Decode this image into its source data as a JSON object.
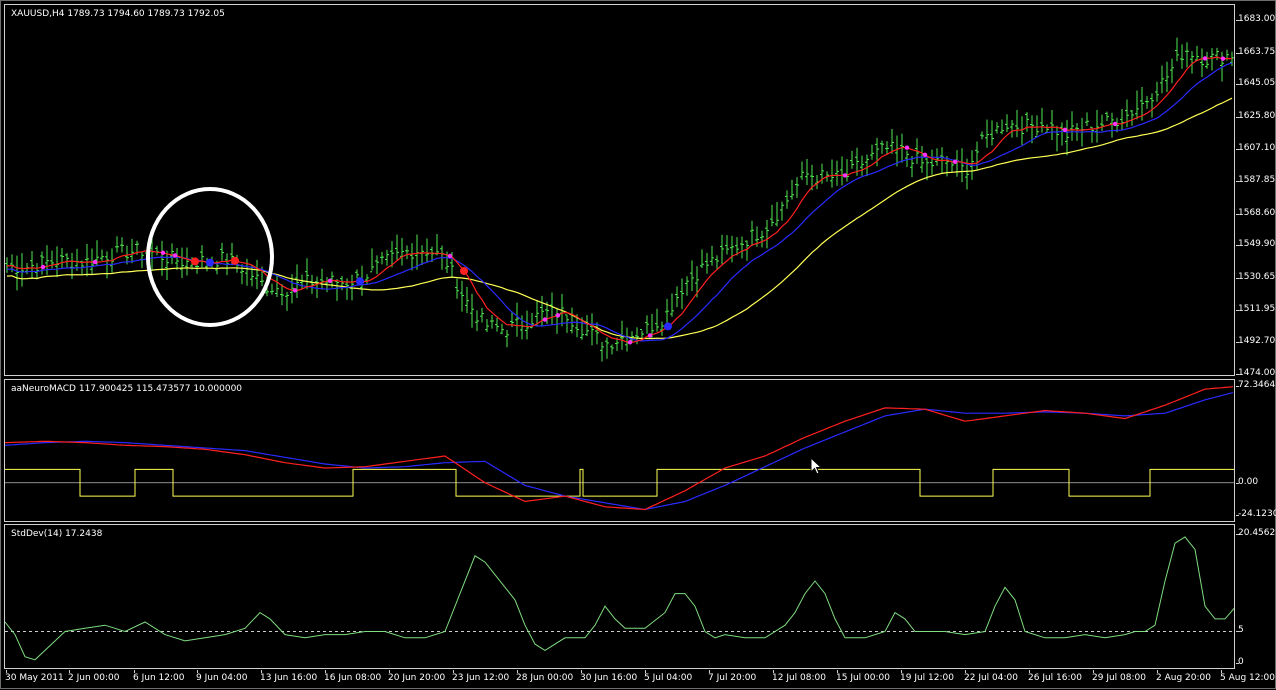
{
  "symbol_header": "XAUUSD,H4  1789.73 1794.60 1789.73 1792.05",
  "macd_header": "aaNeuroMACD 117.900425 115.473577 10.000000",
  "std_header": "StdDev(14) 17.2438",
  "colors": {
    "bars": "#4fe94f",
    "fast_ma": "#ff2020",
    "mid_ma": "#2a2aff",
    "slow_ma": "#ffff55",
    "signal_pink": "#ff33ff",
    "signal_red": "#ff2020",
    "signal_blue": "#2a2aff",
    "stddev_line": "#7fdc7f",
    "macd_main": "#ff2020",
    "macd_signal": "#2a2aff",
    "macd_step": "#ffff55"
  },
  "chart_data": [
    {
      "type": "line",
      "title": "XAUUSD,H4",
      "y_ticks": [
        "1683.00",
        "1663.75",
        "1645.05",
        "1625.80",
        "1607.10",
        "1587.85",
        "1568.60",
        "1549.90",
        "1530.65",
        "1511.95",
        "1492.70",
        "1474.00"
      ],
      "ylim": [
        1474.0,
        1683.0
      ],
      "series": [
        {
          "name": "",
          "kind": "price_bars",
          "x": [
            0,
            20,
            40,
            60,
            80,
            100,
            120,
            140,
            160,
            180,
            200,
            220,
            240,
            260,
            280,
            300,
            320,
            340,
            360,
            380,
            400,
            420,
            440,
            460,
            480,
            500,
            520,
            540,
            560,
            580,
            600,
            620,
            640,
            660,
            680,
            700,
            720,
            740,
            760,
            780,
            800,
            820,
            840,
            860,
            880,
            900,
            920,
            940,
            960,
            980,
            1000,
            1020,
            1040,
            1060,
            1080,
            1100,
            1120,
            1140,
            1160,
            1180,
            1200,
            1220,
            1231
          ],
          "values": [
            1538,
            1537,
            1540,
            1541,
            1540,
            1544,
            1546,
            1547,
            1543,
            1540,
            1541,
            1542,
            1536,
            1526,
            1524,
            1528,
            1529,
            1528,
            1532,
            1540,
            1546,
            1548,
            1542,
            1518,
            1503,
            1500,
            1505,
            1510,
            1510,
            1500,
            1492,
            1496,
            1500,
            1508,
            1528,
            1538,
            1545,
            1553,
            1560,
            1575,
            1592,
            1590,
            1590,
            1600,
            1607,
            1605,
            1597,
            1600,
            1594,
            1613,
            1622,
            1620,
            1622,
            1615,
            1620,
            1622,
            1626,
            1635,
            1648,
            1666,
            1660,
            1662,
            1663
          ]
        }
      ]
    },
    {
      "type": "line",
      "title": "aaNeuroMACD",
      "y_ticks": [
        "72.3464",
        "0.00",
        "-24.1230"
      ],
      "ylim": [
        -24.123,
        72.3464
      ],
      "series": [
        {
          "name": "",
          "x": [
            0,
            40,
            80,
            120,
            160,
            200,
            240,
            280,
            320,
            360,
            400,
            440,
            480,
            520,
            560,
            600,
            640,
            680,
            720,
            760,
            800,
            840,
            880,
            920,
            960,
            1000,
            1040,
            1080,
            1120,
            1160,
            1200,
            1231
          ],
          "values": [
            30,
            31,
            30,
            28,
            27,
            25,
            21,
            15,
            11,
            12,
            16,
            20,
            0,
            -14,
            -10,
            -18,
            -20,
            -6,
            11,
            20,
            34,
            46,
            56,
            55,
            46,
            50,
            54,
            52,
            48,
            58,
            70,
            72
          ]
        },
        {
          "name": "",
          "x": [
            0,
            40,
            80,
            120,
            160,
            200,
            240,
            280,
            320,
            360,
            400,
            440,
            480,
            520,
            560,
            600,
            640,
            680,
            720,
            760,
            800,
            840,
            880,
            920,
            960,
            1000,
            1040,
            1080,
            1120,
            1160,
            1200,
            1231
          ],
          "values": [
            28,
            30,
            31,
            30,
            28,
            26,
            24,
            19,
            14,
            11,
            12,
            15,
            16,
            -2,
            -10,
            -15,
            -20,
            -14,
            -2,
            12,
            26,
            38,
            50,
            55,
            52,
            52,
            53,
            52,
            50,
            52,
            62,
            68
          ]
        },
        {
          "name": "",
          "kind": "step",
          "levels": [
            10,
            -10
          ],
          "segments": [
            [
              0,
              75,
              "hi"
            ],
            [
              75,
              130,
              "lo"
            ],
            [
              130,
              168,
              "hi"
            ],
            [
              168,
              348,
              "lo"
            ],
            [
              348,
              451,
              "hi"
            ],
            [
              451,
              575,
              "lo"
            ],
            [
              575,
              578,
              "hi"
            ],
            [
              578,
              652,
              "lo"
            ],
            [
              652,
              915,
              "hi"
            ],
            [
              915,
              988,
              "lo"
            ],
            [
              988,
              1064,
              "hi"
            ],
            [
              1064,
              1145,
              "lo"
            ],
            [
              1145,
              1231,
              "hi"
            ]
          ]
        }
      ]
    },
    {
      "type": "line",
      "title": "StdDev(14)",
      "y_ticks": [
        "20.4562",
        "5",
        "0"
      ],
      "ylim": [
        0,
        20.4562
      ],
      "reference_line": 5,
      "series": [
        {
          "name": "",
          "x": [
            0,
            10,
            20,
            30,
            40,
            60,
            80,
            100,
            120,
            140,
            160,
            180,
            200,
            220,
            240,
            255,
            265,
            280,
            300,
            320,
            340,
            360,
            380,
            400,
            420,
            440,
            455,
            470,
            480,
            490,
            500,
            510,
            520,
            530,
            540,
            560,
            580,
            590,
            600,
            610,
            620,
            640,
            660,
            670,
            680,
            690,
            700,
            710,
            720,
            740,
            760,
            770,
            780,
            790,
            800,
            810,
            820,
            830,
            840,
            860,
            880,
            890,
            900,
            910,
            920,
            940,
            960,
            980,
            990,
            1000,
            1010,
            1020,
            1040,
            1060,
            1080,
            1100,
            1120,
            1130,
            1140,
            1150,
            1160,
            1170,
            1180,
            1190,
            1200,
            1210,
            1220,
            1231
          ],
          "values": [
            6.5,
            4.5,
            1,
            0.5,
            2,
            5,
            5.5,
            6,
            5,
            6.5,
            4.5,
            3.5,
            4,
            4.5,
            5.5,
            8,
            7,
            4.5,
            4,
            4.5,
            4.5,
            5,
            5,
            4,
            4,
            5,
            11,
            17,
            16,
            14,
            12,
            10,
            6,
            3,
            2,
            4,
            4,
            6,
            9,
            7,
            5.5,
            5.5,
            8,
            11,
            11,
            9,
            5,
            4,
            4.5,
            4,
            4,
            5,
            6,
            8,
            11,
            13,
            11,
            7,
            4,
            4,
            5,
            8,
            7,
            5,
            5,
            5,
            4.5,
            5,
            9,
            12,
            10,
            5,
            4,
            4,
            4.5,
            4,
            4.5,
            5,
            5,
            6,
            13,
            19,
            20,
            18,
            9,
            7,
            7,
            9
          ]
        }
      ]
    }
  ],
  "x_ticks": [
    "30 May 2011",
    "2 Jun 00:00",
    "6 Jun 12:00",
    "9 Jun 04:00",
    "13 Jun 16:00",
    "16 Jun 08:00",
    "20 Jun 20:00",
    "23 Jun 12:00",
    "28 Jun 00:00",
    "30 Jun 16:00",
    "5 Jul 04:00",
    "7 Jul 20:00",
    "12 Jul 08:00",
    "15 Jul 00:00",
    "19 Jul 12:00",
    "22 Jul 04:00",
    "26 Jul 16:00",
    "29 Jul 08:00",
    "2 Aug 20:00",
    "5 Aug 12:00"
  ]
}
